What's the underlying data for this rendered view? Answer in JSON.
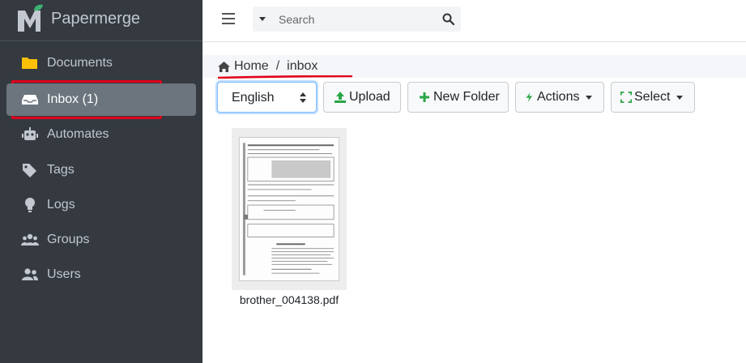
{
  "brand": {
    "name": "Papermerge"
  },
  "sidebar": {
    "items": [
      {
        "label": "Documents"
      },
      {
        "label": "Inbox (1)"
      },
      {
        "label": "Automates"
      },
      {
        "label": "Tags"
      },
      {
        "label": "Logs"
      },
      {
        "label": "Groups"
      },
      {
        "label": "Users"
      }
    ]
  },
  "search": {
    "placeholder": "Search"
  },
  "breadcrumb": {
    "home": "Home",
    "separator": "/",
    "current": "inbox"
  },
  "toolbar": {
    "language": "English",
    "upload": "Upload",
    "new_folder": "New Folder",
    "actions": "Actions",
    "select": "Select"
  },
  "files": [
    {
      "name": "brother_004138.pdf"
    }
  ],
  "colors": {
    "sidebar_bg": "#343a40",
    "active_item_bg": "#6c757d",
    "highlight_red": "#e0001a",
    "upload_green": "#28a745",
    "brand_leaf": "#3cb371"
  }
}
